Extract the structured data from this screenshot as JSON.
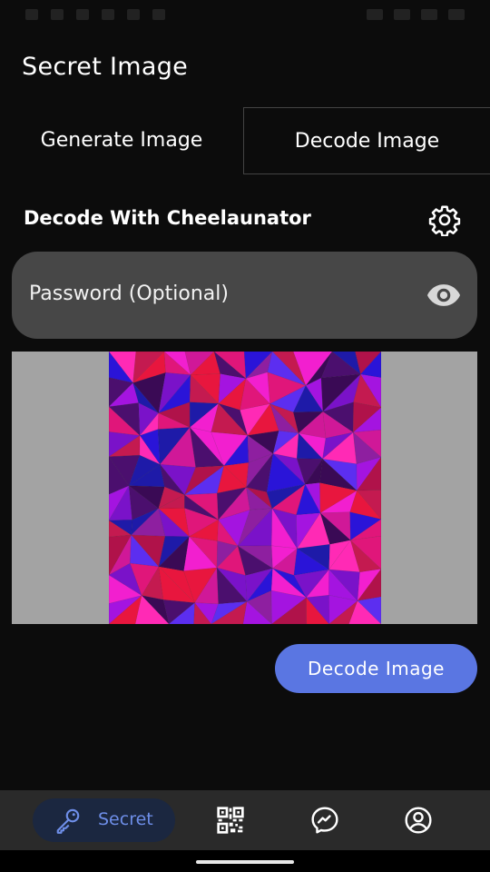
{
  "app": {
    "title": "Secret Image"
  },
  "tabs": [
    {
      "label": "Generate Image",
      "selected": false
    },
    {
      "label": "Decode Image",
      "selected": true
    }
  ],
  "decode": {
    "section_title": "Decode With Cheelaunator",
    "settings_icon": "gear-icon",
    "password_placeholder": "Password (Optional)",
    "visibility_icon": "eye-icon",
    "action_label": "Decode Image"
  },
  "bottom_nav": {
    "items": [
      {
        "label": "Secret",
        "icon": "key-icon",
        "active": true
      },
      {
        "label": "",
        "icon": "qr-code-icon",
        "active": false
      },
      {
        "label": "",
        "icon": "messenger-icon",
        "active": false
      },
      {
        "label": "",
        "icon": "account-icon",
        "active": false
      }
    ]
  },
  "colors": {
    "background": "#0c0c0c",
    "accent": "#5a76e2",
    "field": "#474747",
    "nav_active_bg": "#1b2740",
    "nav_active_fg": "#6e8ee8"
  }
}
